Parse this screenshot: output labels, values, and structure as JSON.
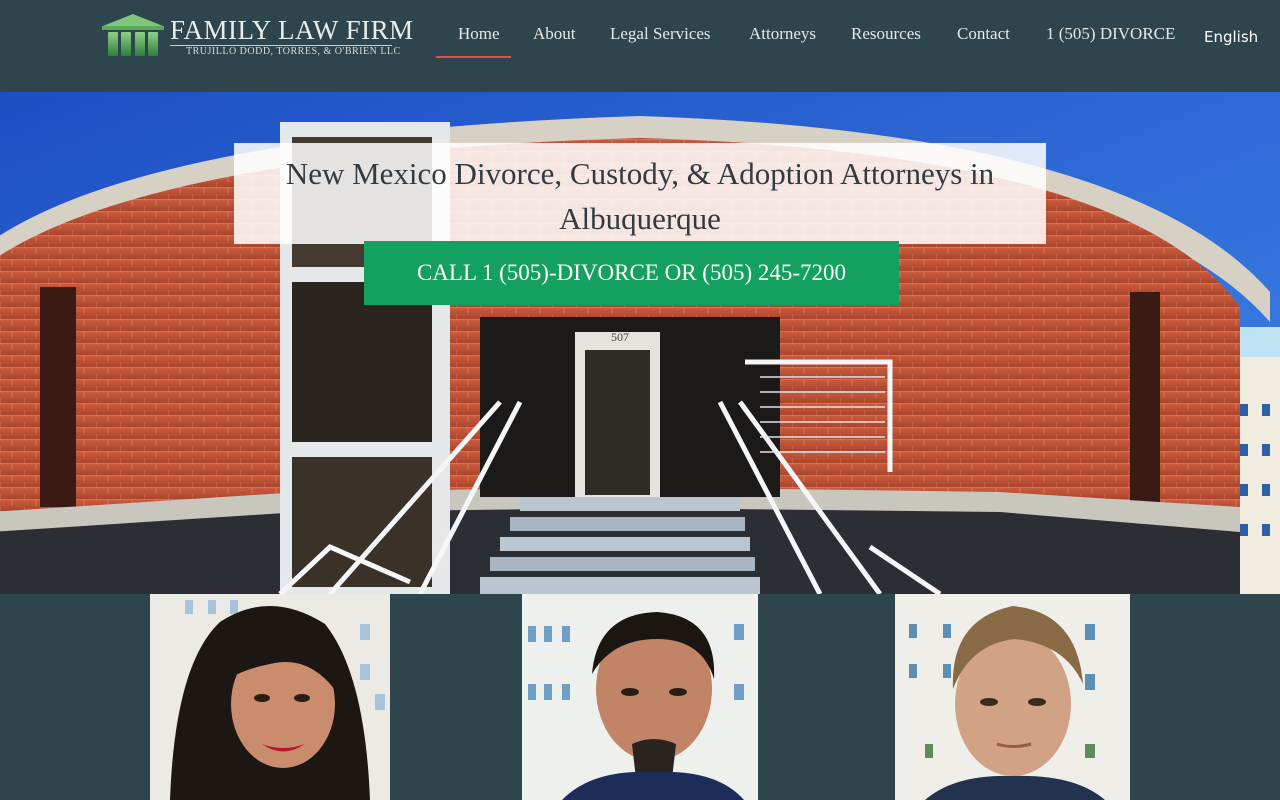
{
  "header": {
    "logo": {
      "name": "FAMILY LAW FIRM",
      "subtitle": "TRUJILLO DODD, TORRES, & O'BRIEN LLC"
    },
    "nav": [
      {
        "label": "Home",
        "active": true
      },
      {
        "label": "About"
      },
      {
        "label": "Legal Services"
      },
      {
        "label": "Attorneys"
      },
      {
        "label": "Resources"
      },
      {
        "label": "Contact"
      },
      {
        "label": "1 (505) DIVORCE"
      }
    ],
    "language": "English"
  },
  "hero": {
    "title": "New Mexico Divorce, Custody, & Adoption Attorneys in Albuquerque",
    "building_number": "507",
    "cta": "CALL 1 (505)-DIVORCE OR (505) 245-7200"
  },
  "colors": {
    "header_bg": "#2f454d",
    "accent_underline": "#d9534f",
    "cta_green": "#14a05f",
    "sky": "#2a62cf",
    "brick": "#c4543a"
  },
  "team": {
    "photos": [
      {
        "name": "attorney-photo-1"
      },
      {
        "name": "attorney-photo-2"
      },
      {
        "name": "attorney-photo-3"
      }
    ]
  }
}
